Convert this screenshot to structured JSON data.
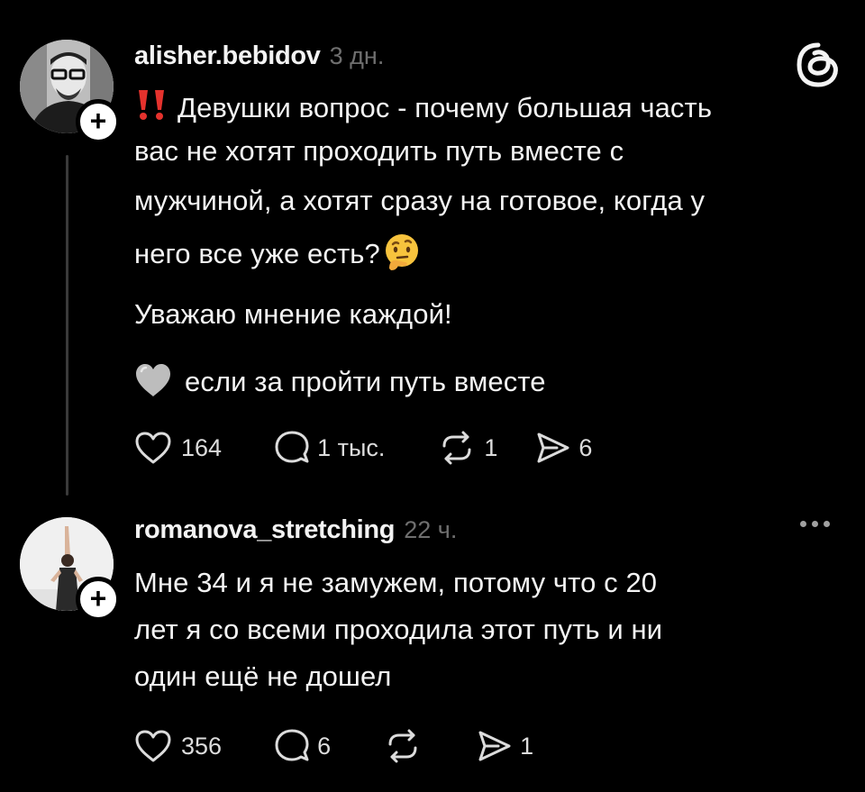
{
  "posts": [
    {
      "username": "alisher.bebidov",
      "time": "3 дн.",
      "lines": [
        "Девушки вопрос - почему большая часть",
        "вас не хотят проходить путь вместе с",
        "мужчиной, а хотят сразу на готовое, когда у",
        "него все уже есть?"
      ],
      "line2": "Уважаю мнение каждой!",
      "line3": "если за пройти путь вместе",
      "likes": "164",
      "replies": "1 тыс.",
      "reposts": "1",
      "shares": "6"
    },
    {
      "username": "romanova_stretching",
      "time": "22 ч.",
      "lines": [
        "Мне 34 и я не замужем, потому что с 20",
        "лет я со всеми проходила этот путь и ни",
        "один ещё не дошел"
      ],
      "likes": "356",
      "replies": "6",
      "reposts": "",
      "shares": "1"
    }
  ],
  "icons": {
    "app_logo": "threads-logo-icon",
    "alert": "double-exclamation-icon",
    "thinking": "thinking-face-icon",
    "heart": "grey-heart-icon"
  },
  "colors": {
    "background": "#000000",
    "text": "#f3f3f3",
    "muted": "#6f6f6f",
    "alert_red": "#e5322d"
  }
}
